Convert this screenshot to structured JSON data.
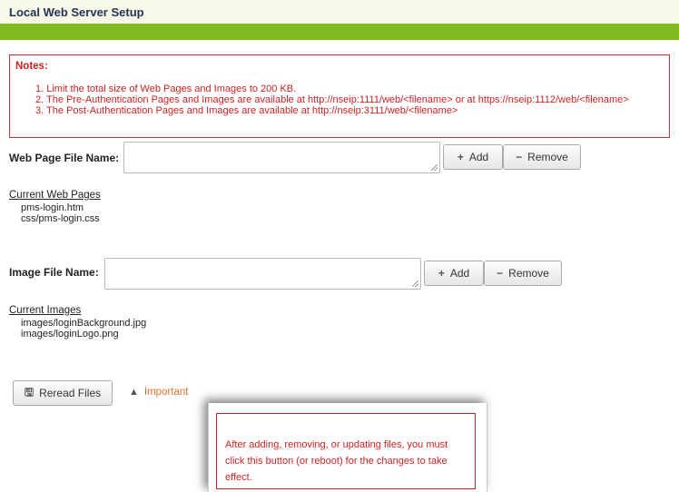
{
  "header": {
    "title": "Local Web Server Setup"
  },
  "notes": {
    "title": "Notes:",
    "items": [
      "1. Limit the total size of Web Pages and Images to 200 KB.",
      "2. The Pre-Authentication Pages and Images are available at http://nseip:1111/web/<filename> or at https://nseip:1112/web/<filename>",
      "3. The Post-Authentication Pages and Images are available at http://nseip:3111/web/<filename>"
    ]
  },
  "web_page": {
    "label": "Web Page File Name:",
    "value": "",
    "add_label": "Add",
    "remove_label": "Remove",
    "list_heading": "Current Web Pages",
    "files": [
      "pms-login.htm",
      "css/pms-login.css"
    ]
  },
  "image": {
    "label": "Image File Name:",
    "value": "",
    "add_label": "Add",
    "remove_label": "Remove",
    "list_heading": "Current Images",
    "files": [
      "images/loginBackground.jpg",
      "images/loginLogo.png"
    ]
  },
  "reread": {
    "label": "Reread Files"
  },
  "important": {
    "label": "Important",
    "icon": "warning-icon"
  },
  "tooltip": {
    "text": "After adding, removing, or updating files, you must click this button (or reboot) for the changes to take effect."
  },
  "colors": {
    "accent_green": "#7fba1e",
    "notes_red": "#cc2222",
    "important_orange": "#e0732a"
  }
}
